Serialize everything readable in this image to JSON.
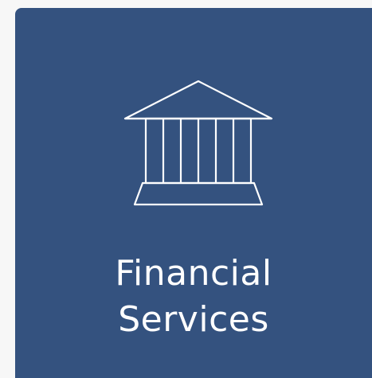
{
  "tile": {
    "icon": "bank-building-icon",
    "label_line1": "Financial",
    "label_line2": "Services",
    "background_color": "#34527f",
    "text_color": "#ffffff"
  }
}
